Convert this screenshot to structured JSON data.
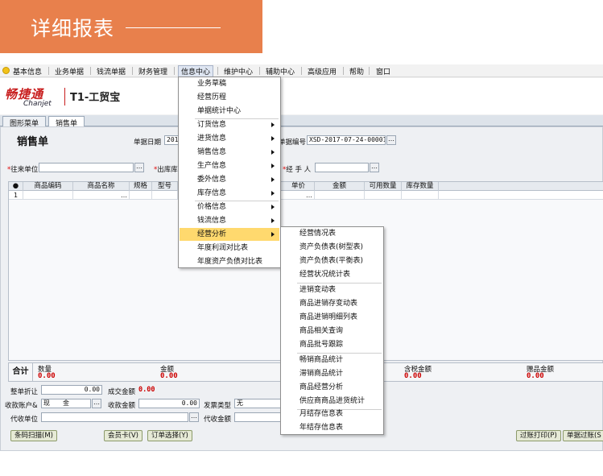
{
  "banner": {
    "title": "详细报表"
  },
  "menubar": {
    "items": [
      "基本信息",
      "业务单据",
      "钱流单据",
      "财务管理",
      "信息中心",
      "维护中心",
      "辅助中心",
      "高级应用",
      "帮助",
      "窗口"
    ]
  },
  "logo": {
    "cn": "畅捷通",
    "en": "Chanjet",
    "product": "T1-工贸宝"
  },
  "tabs": [
    "图形菜单",
    "销售单"
  ],
  "form": {
    "title": "销售单",
    "date_label": "单据日期",
    "date_value": "2017",
    "docno_label": "单据编号",
    "docno_value": "XSD-2017-07-24-00001",
    "customer_label": "往来单位",
    "warehouse_label": "出库库",
    "handler_label": "经 手 人",
    "grid_headers": [
      "商品编码",
      "商品名称",
      "规格",
      "型号",
      "单价",
      "金额",
      "可用数量",
      "库存数量"
    ],
    "grid_row_no": "1",
    "totals_head": "合计",
    "total_qty_label": "数量",
    "total_qty_value": "0.00",
    "total_amount_label": "金额",
    "total_amount_value": "0.00",
    "total_tax_label": "含税金额",
    "total_tax_value": "0.00",
    "total_gift_label": "赠品金额",
    "total_gift_value": "0.00",
    "discount_label": "整单折让",
    "discount_value": "0.00",
    "deal_amount_label": "成交金额",
    "deal_amount_value": "0.00",
    "pay_account_label": "收款账户&",
    "pay_account_value": "现　　金",
    "received_label": "收款金额",
    "received_value": "0.00",
    "invoice_label": "发票类型",
    "invoice_value": "无",
    "agent_unit_label": "代收单位",
    "agent_amount_label": "代收金额"
  },
  "buttons": {
    "barcode": "条码扫描(M)",
    "member": "会员卡(V)",
    "order_select": "订单选择(Y)",
    "post_print": "过账打印(P)",
    "post": "单据过账(S"
  },
  "menu_info": {
    "items": [
      "业务草稿",
      "经营历程",
      "单据统计中心",
      "订货信息",
      "进货信息",
      "销售信息",
      "生产信息",
      "委外信息",
      "库存信息",
      "价格信息",
      "钱流信息",
      "经营分析",
      "年度利润对比表",
      "年度资产负债对比表"
    ]
  },
  "menu_analysis": {
    "items": [
      "经营情况表",
      "资产负债表(树型表)",
      "资产负债表(平衡表)",
      "经营状况统计表",
      "进销变动表",
      "商品进销存变动表",
      "商品进销明细列表",
      "商品相关查询",
      "商品批号跟踪",
      "畅销商品统计",
      "滞销商品统计",
      "商品经营分析",
      "供应商商品进货统计",
      "月结存信息表",
      "年结存信息表"
    ]
  }
}
